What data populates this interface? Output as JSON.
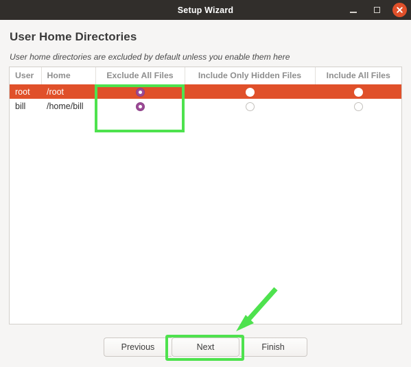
{
  "window": {
    "title": "Setup Wizard",
    "controls": {
      "minimize": "minimize-icon",
      "maximize": "maximize-icon",
      "close": "close-icon"
    }
  },
  "page": {
    "title": "User Home Directories",
    "subtitle": "User home directories are excluded by default unless you enable them here"
  },
  "table": {
    "columns": [
      "User",
      "Home",
      "Exclude All Files",
      "Include Only Hidden Files",
      "Include All Files"
    ],
    "rows": [
      {
        "user": "root",
        "home": "/root",
        "exclude_all": "checked",
        "include_hidden": "unchecked",
        "include_all": "unchecked",
        "selected": true
      },
      {
        "user": "bill",
        "home": "/home/bill",
        "exclude_all": "checked",
        "include_hidden": "unchecked",
        "include_all": "unchecked",
        "selected": false
      }
    ]
  },
  "footer": {
    "previous_label": "Previous",
    "next_label": "Next",
    "finish_label": "Finish"
  },
  "annotations": {
    "highlight_color": "#4ee24e",
    "column_box_target": "Exclude All Files",
    "button_box_target": "Next",
    "arrow_target": "Next"
  },
  "colors": {
    "titlebar": "#312e2b",
    "selected_row": "#e0502a",
    "close_button": "#e0502a",
    "radio_checked": "#9c4a96",
    "panel_background": "#ffffff",
    "window_background": "#f6f5f4"
  }
}
